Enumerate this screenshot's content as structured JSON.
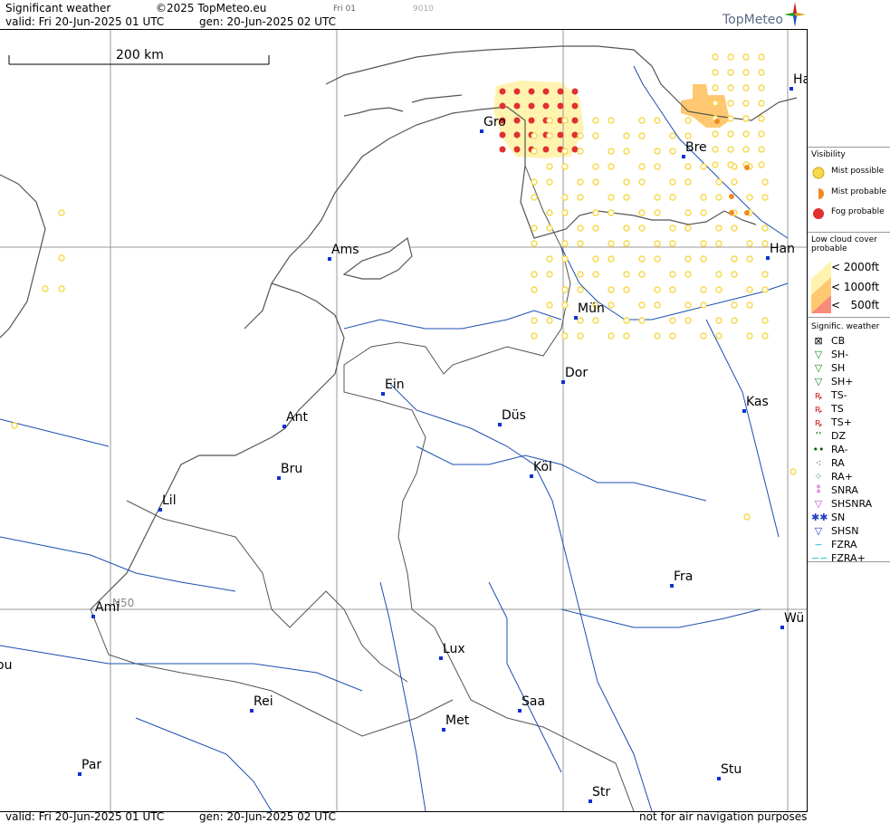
{
  "header": {
    "title": "Significant weather",
    "copyright": "©2025 TopMeteo.eu",
    "day_code": "Fri 01",
    "code": "9010",
    "valid": "valid:  Fri  20-Jun-2025  01 UTC",
    "gen": "gen:  20-Jun-2025  02 UTC",
    "logo": "TopMeteo"
  },
  "map": {
    "scale_label": "200 km",
    "lat_label": "N50",
    "cities": [
      {
        "name": "Gro"
      },
      {
        "name": "Bre"
      },
      {
        "name": "Ha"
      },
      {
        "name": "Ams"
      },
      {
        "name": "Han"
      },
      {
        "name": "Mün"
      },
      {
        "name": "Dor"
      },
      {
        "name": "Ein"
      },
      {
        "name": "Ant"
      },
      {
        "name": "Düs"
      },
      {
        "name": "Kas"
      },
      {
        "name": "Bru"
      },
      {
        "name": "Köl"
      },
      {
        "name": "Lil"
      },
      {
        "name": "Fra"
      },
      {
        "name": "Ami"
      },
      {
        "name": "Wü"
      },
      {
        "name": "Lux"
      },
      {
        "name": "ou"
      },
      {
        "name": "Rei"
      },
      {
        "name": "Saa"
      },
      {
        "name": "Met"
      },
      {
        "name": "Par"
      },
      {
        "name": "Stu"
      },
      {
        "name": "Str"
      }
    ],
    "colors": {
      "mist_possible": "#f7d84a",
      "mist_probable": "#f08a20",
      "fog_probable": "#e03030",
      "cloud_2000": "#fff3b0",
      "cloud_1000": "#ffc870",
      "cloud_500": "#f88a7a",
      "grid": "#9a9a9a",
      "rivers": "#1a4fb0",
      "borders": "#555555"
    }
  },
  "legend": {
    "visibility_title": "Visibility",
    "visibility_items": [
      {
        "label": "Mist possible",
        "icon": "mist-possible-icon"
      },
      {
        "label": "Mist probable",
        "icon": "mist-probable-icon"
      },
      {
        "label": "Fog probable",
        "icon": "fog-probable-icon"
      }
    ],
    "cloud_title": "Low cloud cover probable",
    "cloud_items": [
      {
        "label": "< 2000ft"
      },
      {
        "label": "< 1000ft"
      },
      {
        "label": "<   500ft"
      }
    ],
    "sigwx_title": "Signific. weather",
    "sigwx_items": [
      {
        "label": "CB",
        "icon": "cb-icon",
        "glyph": "⊠",
        "color": "#000"
      },
      {
        "label": "SH-",
        "icon": "shower-light-icon",
        "glyph": "▽",
        "color": "#1a8a1a"
      },
      {
        "label": "SH",
        "icon": "shower-icon",
        "glyph": "▽",
        "color": "#1a8a1a"
      },
      {
        "label": "SH+",
        "icon": "shower-heavy-icon",
        "glyph": "▽",
        "color": "#1a8a1a"
      },
      {
        "label": "TS-",
        "icon": "thunderstorm-light-icon",
        "glyph": "ꝶ",
        "color": "#d02020"
      },
      {
        "label": "TS",
        "icon": "thunderstorm-icon",
        "glyph": "ꝶ",
        "color": "#d02020"
      },
      {
        "label": "TS+",
        "icon": "thunderstorm-heavy-icon",
        "glyph": "ꝶ",
        "color": "#d02020"
      },
      {
        "label": "DZ",
        "icon": "drizzle-icon",
        "glyph": "’’",
        "color": "#0a5a0a"
      },
      {
        "label": "RA-",
        "icon": "rain-light-icon",
        "glyph": "••",
        "color": "#0a5a0a"
      },
      {
        "label": "RA",
        "icon": "rain-icon",
        "glyph": "⁖",
        "color": "#0a5a0a"
      },
      {
        "label": "RA+",
        "icon": "rain-heavy-icon",
        "glyph": "⁘",
        "color": "#0a5a0a"
      },
      {
        "label": "SNRA",
        "icon": "snow-rain-icon",
        "glyph": "⁑",
        "color": "#c050c0"
      },
      {
        "label": "SHSNRA",
        "icon": "snow-rain-shower-icon",
        "glyph": "▽",
        "color": "#c050c0"
      },
      {
        "label": "SN",
        "icon": "snow-icon",
        "glyph": "✱✱",
        "color": "#2040c0"
      },
      {
        "label": "SHSN",
        "icon": "snow-shower-icon",
        "glyph": "▽",
        "color": "#2040c0"
      },
      {
        "label": "FZRA",
        "icon": "freezing-rain-icon",
        "glyph": "∽",
        "color": "#20b8c8"
      },
      {
        "label": "FZRA+",
        "icon": "freezing-rain-heavy-icon",
        "glyph": "∽∽",
        "color": "#20b8c8"
      }
    ]
  },
  "footer": {
    "valid": "valid:  Fri   20-Jun-2025   01 UTC",
    "gen": "gen:  20-Jun-2025  02 UTC",
    "note": "not for air navigation purposes"
  }
}
